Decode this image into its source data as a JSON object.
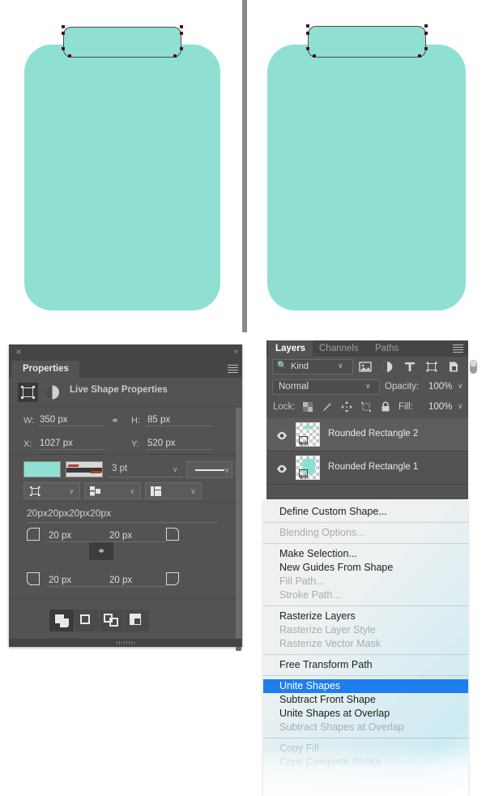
{
  "app": {
    "fill_color": "#8fe0d3",
    "accent_highlight": "#1e7ef0",
    "panel_bg": "#535353"
  },
  "canvas": {
    "left_artwork_name": "rounded-rectangle-clipboard-before-unite",
    "right_artwork_name": "rounded-rectangle-clipboard-after-unite"
  },
  "properties": {
    "tab_label": "Properties",
    "close_glyph": "×",
    "collapse_glyph": "«",
    "section_title": "Live Shape Properties",
    "dimensions": {
      "w_label": "W:",
      "w_value": "350 px",
      "h_label": "H:",
      "h_value": "85 px",
      "x_label": "X:",
      "x_value": "1027 px",
      "y_label": "Y:",
      "y_value": "520 px",
      "link_glyph": "⚭"
    },
    "stroke": {
      "width_value": "3 pt",
      "fill_swatch_color": "#8fe0d3",
      "caret_glyph": "∨"
    },
    "radius": {
      "combined_value": "20px20px20px20px",
      "top_left": "20 px",
      "top_right": "20 px",
      "bottom_left": "20 px",
      "bottom_right": "20 px",
      "link_glyph": "⚭"
    },
    "boolean_ops": [
      {
        "name": "combine-shapes",
        "active": true
      },
      {
        "name": "subtract-front-shape",
        "active": false
      },
      {
        "name": "intersect-shape-areas",
        "active": false
      },
      {
        "name": "exclude-overlapping-shapes",
        "active": false
      }
    ]
  },
  "layers": {
    "tabs": [
      {
        "label": "Layers",
        "active": true
      },
      {
        "label": "Channels",
        "active": false
      },
      {
        "label": "Paths",
        "active": false
      }
    ],
    "filter": {
      "kind_label": "Kind",
      "caret_glyph": "∨"
    },
    "blend": {
      "mode": "Normal",
      "opacity_label": "Opacity:",
      "opacity_value": "100%",
      "caret_glyph": "∨"
    },
    "lock": {
      "label": "Lock:",
      "fill_label": "Fill:",
      "fill_value": "100%",
      "caret_glyph": "∨"
    },
    "rows": [
      {
        "name": "Rounded Rectangle 2",
        "visible": true,
        "selected": true
      },
      {
        "name": "Rounded Rectangle 1",
        "visible": true,
        "selected": false
      }
    ]
  },
  "context_menu": {
    "items": [
      {
        "label": "Define Custom Shape...",
        "state": "normal"
      },
      {
        "label": "__sep__",
        "state": "separator"
      },
      {
        "label": "Blending Options...",
        "state": "disabled"
      },
      {
        "label": "__sep__",
        "state": "separator"
      },
      {
        "label": "Make Selection...",
        "state": "normal"
      },
      {
        "label": "New Guides From Shape",
        "state": "normal"
      },
      {
        "label": "Fill Path...",
        "state": "disabled"
      },
      {
        "label": "Stroke Path...",
        "state": "disabled"
      },
      {
        "label": "__sep__",
        "state": "separator"
      },
      {
        "label": "Rasterize Layers",
        "state": "normal"
      },
      {
        "label": "Rasterize Layer Style",
        "state": "disabled"
      },
      {
        "label": "Rasterize Vector Mask",
        "state": "disabled"
      },
      {
        "label": "__sep__",
        "state": "separator"
      },
      {
        "label": "Free Transform Path",
        "state": "normal"
      },
      {
        "label": "__sep__",
        "state": "separator"
      },
      {
        "label": "Unite Shapes",
        "state": "highlight"
      },
      {
        "label": "Subtract Front Shape",
        "state": "normal"
      },
      {
        "label": "Unite Shapes at Overlap",
        "state": "normal"
      },
      {
        "label": "Subtract Shapes at Overlap",
        "state": "disabled"
      },
      {
        "label": "__sep__",
        "state": "separator"
      },
      {
        "label": "Copy Fill",
        "state": "faded"
      },
      {
        "label": "Copy Complete Stroke",
        "state": "faded"
      }
    ]
  }
}
